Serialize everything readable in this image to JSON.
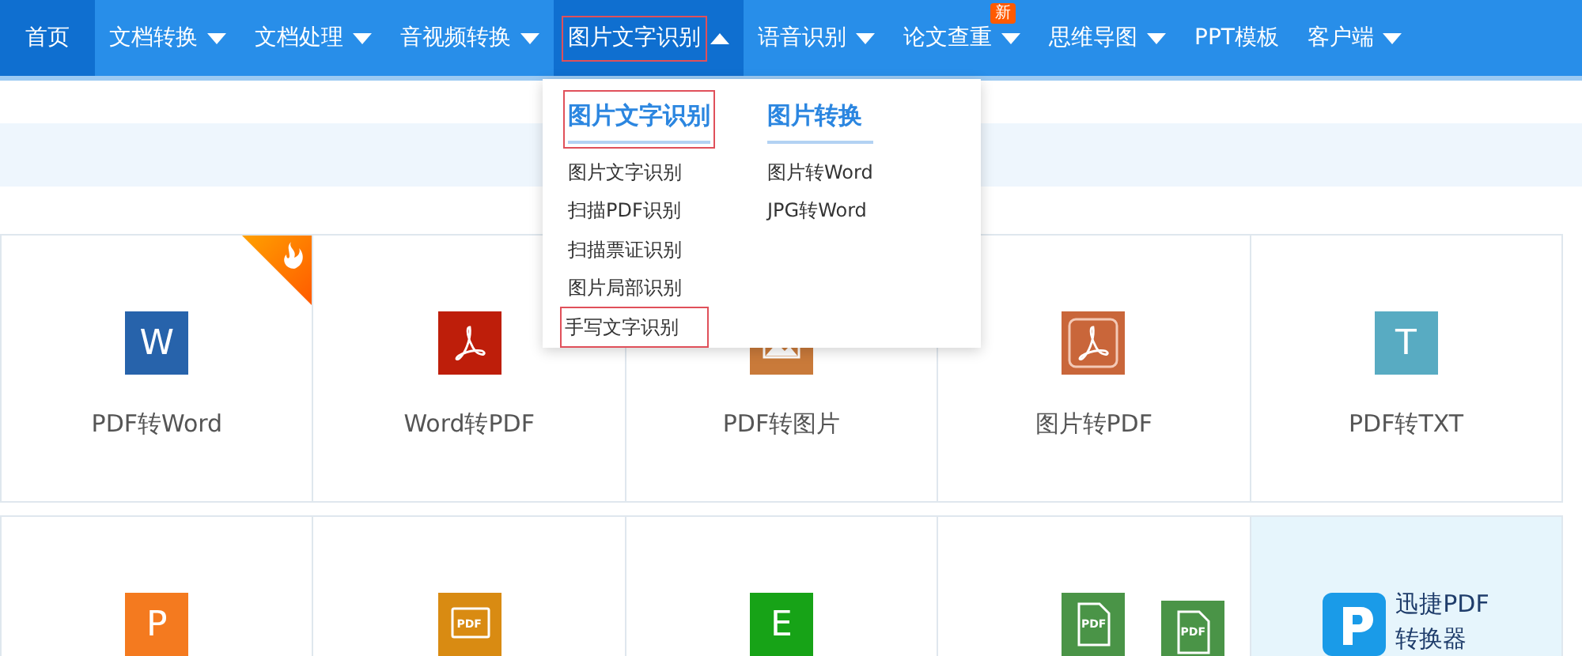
{
  "nav": [
    {
      "label": "首页",
      "has_menu": false,
      "selected": true,
      "highlighted": false
    },
    {
      "label": "文档转换",
      "has_menu": true,
      "expanded": false,
      "selected": false,
      "highlighted": false
    },
    {
      "label": "文档处理",
      "has_menu": true,
      "expanded": false,
      "selected": false,
      "highlighted": false
    },
    {
      "label": "音视频转换",
      "has_menu": true,
      "expanded": false,
      "selected": false,
      "highlighted": false
    },
    {
      "label": "图片文字识别",
      "has_menu": true,
      "expanded": true,
      "selected": true,
      "highlighted": true
    },
    {
      "label": "语音识别",
      "has_menu": true,
      "expanded": false,
      "selected": false,
      "highlighted": false
    },
    {
      "label": "论文查重",
      "has_menu": true,
      "expanded": false,
      "selected": false,
      "highlighted": false,
      "badge": "新"
    },
    {
      "label": "思维导图",
      "has_menu": true,
      "expanded": false,
      "selected": false,
      "highlighted": false
    },
    {
      "label": "PPT模板",
      "has_menu": false,
      "selected": false,
      "highlighted": false
    },
    {
      "label": "客户端",
      "has_menu": true,
      "expanded": false,
      "selected": false,
      "highlighted": false
    }
  ],
  "dropdown": {
    "columns": [
      {
        "heading": "图片文字识别",
        "highlighted": true,
        "items": [
          {
            "label": "图片文字识别",
            "highlighted": false
          },
          {
            "label": "扫描PDF识别",
            "highlighted": false
          },
          {
            "label": "扫描票证识别",
            "highlighted": false
          },
          {
            "label": "图片局部识别",
            "highlighted": false
          },
          {
            "label": "手写文字识别",
            "highlighted": true
          }
        ]
      },
      {
        "heading": "图片转换",
        "highlighted": false,
        "items": [
          {
            "label": "图片转Word",
            "highlighted": false
          },
          {
            "label": "JPG转Word",
            "highlighted": false
          }
        ]
      }
    ]
  },
  "tiles": [
    [
      {
        "label": "PDF转Word",
        "hot": true,
        "icon": {
          "kind": "letter",
          "glyph": "W",
          "color": "#2763ab"
        }
      },
      {
        "label": "Word转PDF",
        "hot": false,
        "icon": {
          "kind": "acrobat",
          "color": "#be1e0a"
        }
      },
      {
        "label": "PDF转图片",
        "hot": false,
        "icon": {
          "kind": "image",
          "color": "#c97a3a"
        }
      },
      {
        "label": "图片转PDF",
        "hot": false,
        "icon": {
          "kind": "acrobat-framed",
          "color": "#c9663a"
        }
      },
      {
        "label": "PDF转TXT",
        "hot": false,
        "icon": {
          "kind": "letter",
          "glyph": "T",
          "color": "#58abc2"
        }
      }
    ],
    [
      {
        "hot": false,
        "icon": {
          "kind": "letter",
          "glyph": "P",
          "color": "#f47a1f"
        }
      },
      {
        "hot": false,
        "icon": {
          "kind": "pdf-screen",
          "glyph": "PDF",
          "color": "#d98b12"
        }
      },
      {
        "hot": false,
        "icon": {
          "kind": "letter",
          "glyph": "E",
          "color": "#17a317"
        }
      },
      {
        "hot": false,
        "icon": {
          "kind": "pdf-doc",
          "glyph": "PDF",
          "color": "#4a9447"
        },
        "extra_icon": {
          "kind": "pdf-doc",
          "glyph": "PDF",
          "color": "#4a9447"
        }
      },
      {
        "kind": "promo",
        "lines": [
          "迅捷PDF",
          "转换器"
        ]
      }
    ]
  ]
}
